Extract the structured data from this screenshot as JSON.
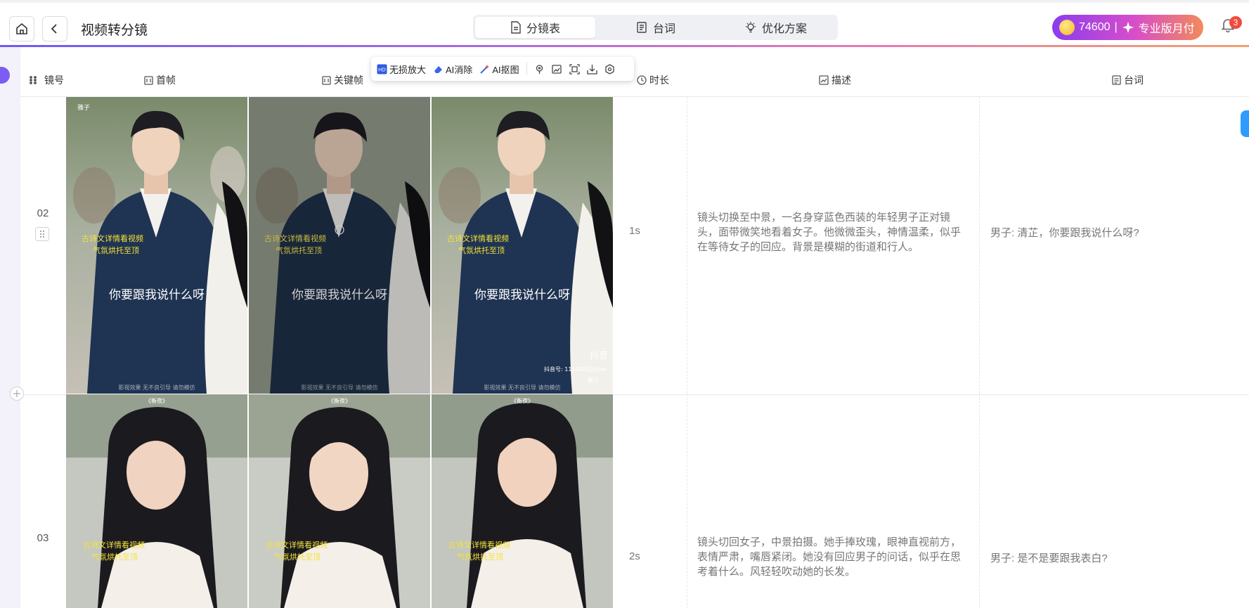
{
  "header": {
    "title": "视频转分镜",
    "tabs": [
      {
        "label": "分镜表",
        "active": true,
        "icon": "document-icon"
      },
      {
        "label": "台词",
        "active": false,
        "icon": "script-icon"
      },
      {
        "label": "优化方案",
        "active": false,
        "icon": "lightbulb-icon"
      }
    ],
    "credits": "74600",
    "separator": "|",
    "plan_label": "专业版月付",
    "notification_count": "3"
  },
  "columns": {
    "shot": "镜号",
    "first_frame": "首帧",
    "key_frame": "关键帧",
    "duration": "时长",
    "description": "描述",
    "dialogue": "台词"
  },
  "toolbar": {
    "upscale": "无损放大",
    "erase": "AI消除",
    "cutout": "AI抠图"
  },
  "rows": [
    {
      "shot": "02",
      "frame_subtitle": "你要跟我说什么呀",
      "frame_watermark": "影视效果 无不良引导 请勿模仿",
      "frame_caption_1": "古诗文详情看视频",
      "frame_caption_2": "气氛烘托至顶",
      "douyin_label": "抖音",
      "douyin_id": "抖音号: 111688520yan",
      "douyin_search": "雅子",
      "duration": "1s",
      "description": "镜头切换至中景，一名身穿蓝色西装的年轻男子正对镜头，面带微笑地看着女子。他微微歪头，神情温柔，似乎在等待女子的回应。背景是模糊的街道和行人。",
      "dialogue": "男子: 清芷，你要跟我说什么呀?"
    },
    {
      "shot": "03",
      "frame_top_label": "《衡夜》",
      "frame_caption_1": "古诗文详情看视频",
      "frame_caption_2": "气氛烘托至顶",
      "duration": "2s",
      "description": "镜头切回女子，中景拍摄。她手捧玫瑰，眼神直视前方，表情严肃，嘴唇紧闭。她没有回应男子的问话，似乎在思考着什么。风轻轻吹动她的长发。",
      "dialogue": "男子: 是不是要跟我表白?"
    }
  ],
  "colors": {
    "accent_purple": "#7d5cf4",
    "pro_gradient_start": "#8a3cf0",
    "pro_gradient_end": "#f28a5a",
    "badge_red": "#f24a3c",
    "side_blue": "#2f9bff"
  }
}
